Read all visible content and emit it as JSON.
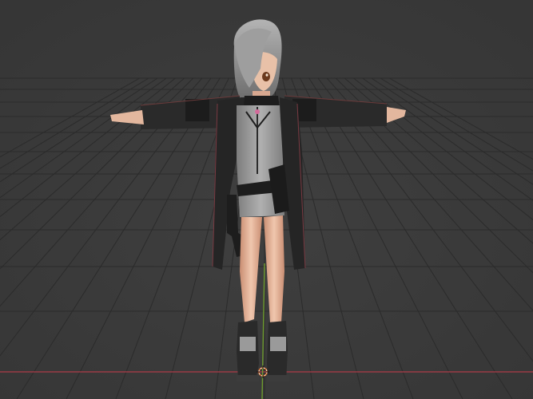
{
  "viewport": {
    "background": "#3b3b3b",
    "grid_color": "#2b2b2b",
    "x_axis_color": "#9a3a45",
    "y_axis_color": "#6d9a2f",
    "origin_color": "#e8e8e8"
  },
  "model": {
    "hair_color": "#8f8f8f",
    "skin_color": "#e3b79e",
    "jacket_color": "#232323",
    "dress_color": "#9b9b9b",
    "boot_color": "#2a2a2a"
  }
}
